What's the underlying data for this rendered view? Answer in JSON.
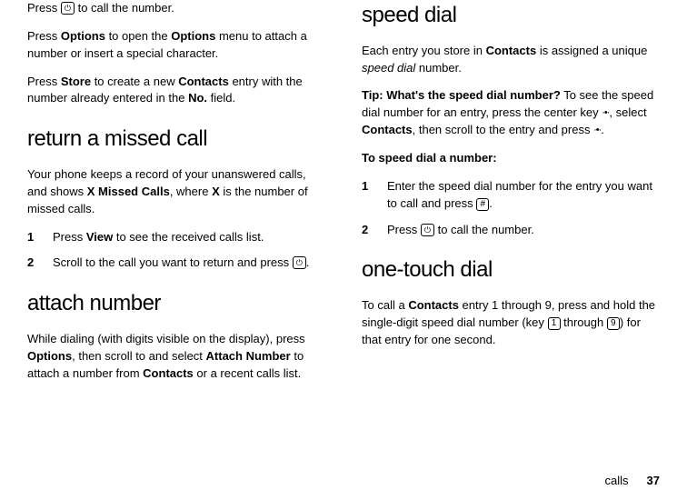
{
  "left": {
    "p1a": "Press ",
    "p1b": " to call the number.",
    "p2a": "Press ",
    "p2b": "Options",
    "p2c": " to open the ",
    "p2d": "Options",
    "p2e": " menu to attach a number or insert a special character.",
    "p3a": "Press ",
    "p3b": "Store",
    "p3c": " to create a new ",
    "p3d": "Contacts",
    "p3e": " entry with the number already entered in the ",
    "p3f": "No.",
    "p3g": " field.",
    "h1": "return a missed call",
    "p4a": "Your phone keeps a record of your unanswered calls, and shows ",
    "p4b": "X Missed Calls",
    "p4c": ", where ",
    "p4d": "X",
    "p4e": " is the number of missed calls.",
    "li1n": "1",
    "li1a": "Press ",
    "li1b": "View",
    "li1c": " to see the received calls list.",
    "li2n": "2",
    "li2a": "Scroll to the call you want to return and press ",
    "li2b": ".",
    "h2": "attach number",
    "p5a": "While dialing (with digits visible on the display), press ",
    "p5b": "Options",
    "p5c": ", then scroll to and select ",
    "p5d": "Attach Number",
    "p5e": " to attach a number from ",
    "p5f": "Contacts",
    "p5g": " or a recent calls list."
  },
  "right": {
    "h1": "speed dial",
    "p1a": "Each entry you store in ",
    "p1b": "Contacts",
    "p1c": " is assigned a unique ",
    "p1d": "speed dial",
    "p1e": " number.",
    "p2a": "Tip: What's the speed dial number?",
    "p2b": " To see the speed dial number for an entry, press the center key ",
    "p2c": ", select ",
    "p2d": "Contacts",
    "p2e": ", then scroll to the entry and press  ",
    "p2f": ".",
    "p3": "To speed dial a number:",
    "li1n": "1",
    "li1a": "Enter the speed dial number for the entry you want to call and press ",
    "li1b": ".",
    "li2n": "2",
    "li2a": "Press ",
    "li2b": " to call the number.",
    "h2": "one-touch dial",
    "p4a": "To call a ",
    "p4b": "Contacts",
    "p4c": " entry 1 through 9, press and hold the single-digit speed dial number (key ",
    "p4d": " through ",
    "p4e": ") for that entry for one second."
  },
  "keys": {
    "call": "⏻",
    "hash": "#",
    "one": "1",
    "nine": "9",
    "nav": "·•·"
  },
  "footer": {
    "section": "calls",
    "page": "37"
  }
}
